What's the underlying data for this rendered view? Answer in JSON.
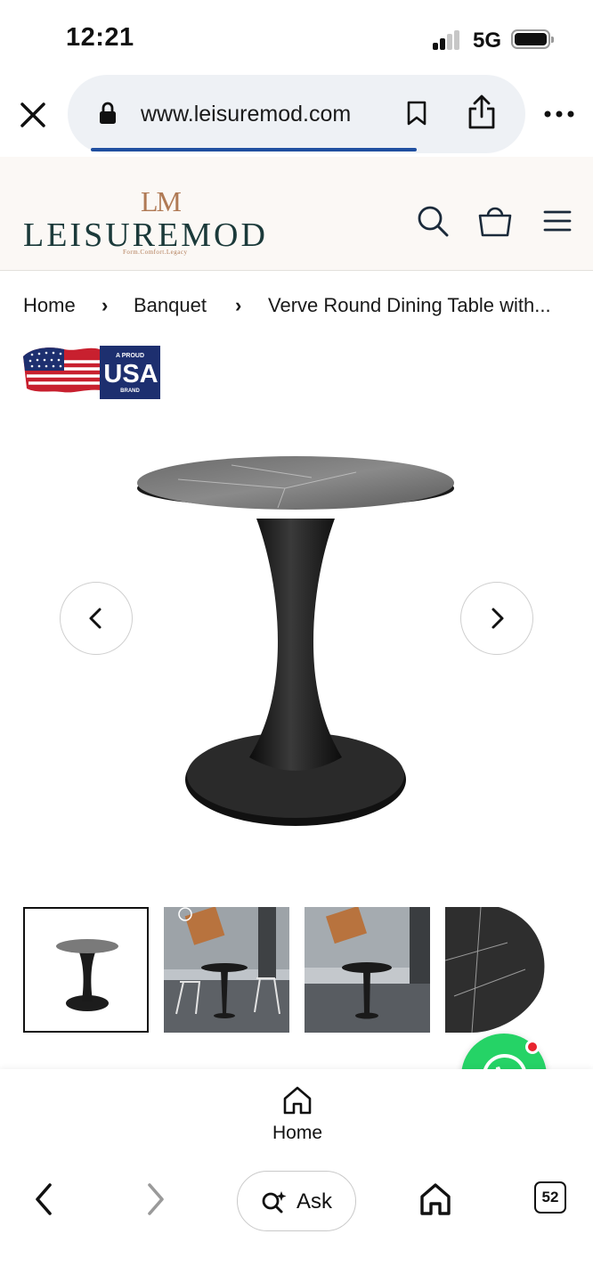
{
  "status_bar": {
    "time": "12:21",
    "network": "5G"
  },
  "browser": {
    "url": "www.leisuremod.com"
  },
  "site_header": {
    "logo_mark": "LM",
    "logo_text": "LEISUREMOD",
    "logo_tagline": "Form.Comfort.Legacy"
  },
  "breadcrumb": {
    "items": [
      "Home",
      "Banquet",
      "Verve Round Dining Table with..."
    ],
    "separator": "›"
  },
  "badge": {
    "line1": "A PROUD",
    "line2": "USA",
    "line3": "BRAND"
  },
  "product": {
    "image_alt": "black pedestal round table with sintered stone top",
    "thumbnails": [
      {
        "active": true
      },
      {
        "active": false
      },
      {
        "active": false
      },
      {
        "active": false
      }
    ]
  },
  "site_nav": {
    "home_label": "Home"
  },
  "toolbar": {
    "ask_label": "Ask",
    "tab_count": "52"
  },
  "colors": {
    "brand_teal": "#1b3a3a",
    "brand_bronze": "#b07a55",
    "whatsapp": "#25d366",
    "load_bar": "#1f4fa0"
  }
}
